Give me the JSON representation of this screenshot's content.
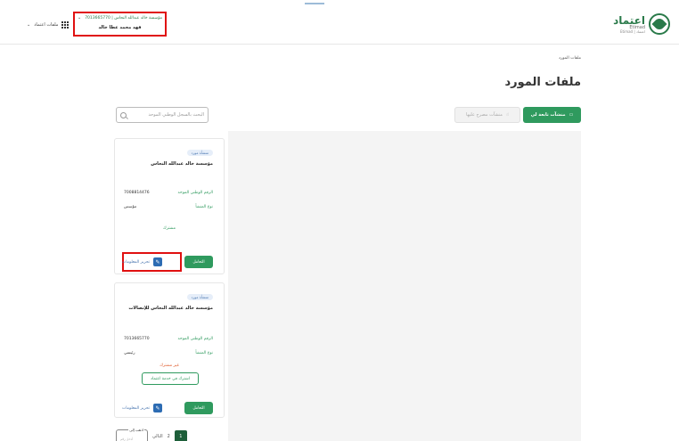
{
  "header": {
    "logo_ar": "اعتماد",
    "logo_en": "Etimad",
    "logo_en2": "Etimad | اعتماد",
    "user_org_line": "مؤسسة خالد عبدالله النحاس | 7013665770",
    "user_name": "فهد محمد عطا خالد",
    "files_menu_label": "ملفات اعتماد"
  },
  "page": {
    "breadcrumb": "ملفات المورد",
    "title": "ملفات المورد",
    "search_placeholder": "البحث بالسجل الوطني الموحد",
    "tab_active": "منشآت تابعة لي",
    "tab_inactive": "منشآت مصرح عليها"
  },
  "cards": [
    {
      "tag": "منشأة مورد",
      "name": "مؤسسة خالد عبدالله النحاس",
      "unified_label": "الرقم الوطني الموحد",
      "unified_value": "7008814476",
      "type_label": "نوع المنشأ",
      "type_value": "مؤسس",
      "status": "مشترك",
      "deal_label": "التعامل",
      "edit_label": "تحرير المعلومات"
    },
    {
      "tag": "منشأة مورد",
      "name": "مؤسسة خالد عبدالله النحاس للإتصالات",
      "unified_label": "الرقم الوطني الموحد",
      "unified_value": "7013665770",
      "type_label": "نوع المنشأ",
      "type_value": "رئيسي",
      "late": "غير مشترك",
      "subscribe": "اشترك في خدمة اعتماد",
      "deal_label": "التعامل",
      "edit_label": "تحرير المعلومات"
    }
  ],
  "pager": {
    "goto_label": "اذهب إلى",
    "goto_placeholder": "أدخل رقم",
    "next": "التالي",
    "page2": "2",
    "page1": "1"
  },
  "colors": {
    "brand_green": "#2f9a5e",
    "highlight_red": "#e01010"
  }
}
